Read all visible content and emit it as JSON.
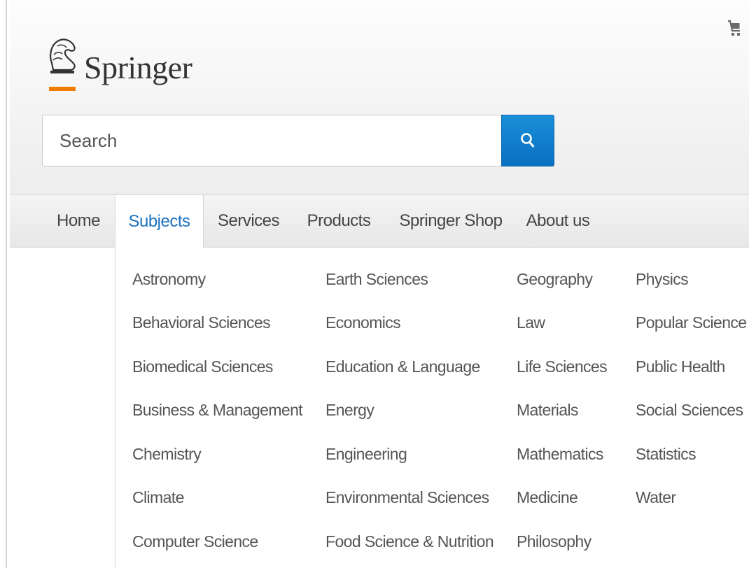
{
  "brand": {
    "name": "Springer"
  },
  "search": {
    "placeholder": "Search"
  },
  "colors": {
    "accent": "#1b72c0",
    "logo_underline": "#f07d00",
    "search_button": "#0a7ccc"
  },
  "nav": {
    "tabs": [
      {
        "label": "Home"
      },
      {
        "label": "Subjects",
        "active": true
      },
      {
        "label": "Services"
      },
      {
        "label": "Products"
      },
      {
        "label": "Springer Shop"
      },
      {
        "label": "About us"
      }
    ]
  },
  "subjects": {
    "columns": [
      [
        "Astronomy",
        "Behavioral Sciences",
        "Biomedical Sciences",
        "Business & Management",
        "Chemistry",
        "Climate",
        "Computer Science"
      ],
      [
        "Earth Sciences",
        "Economics",
        "Education & Language",
        "Energy",
        "Engineering",
        "Environmental Sciences",
        "Food Science & Nutrition"
      ],
      [
        "Geography",
        "Law",
        "Life Sciences",
        "Materials",
        "Mathematics",
        "Medicine",
        "Philosophy"
      ],
      [
        "Physics",
        "Popular Science",
        "Public Health",
        "Social Sciences",
        "Statistics",
        "Water"
      ]
    ]
  },
  "icons": {
    "cart": "cart-icon",
    "search": "search-icon",
    "logo": "chess-knight-logo-icon"
  }
}
